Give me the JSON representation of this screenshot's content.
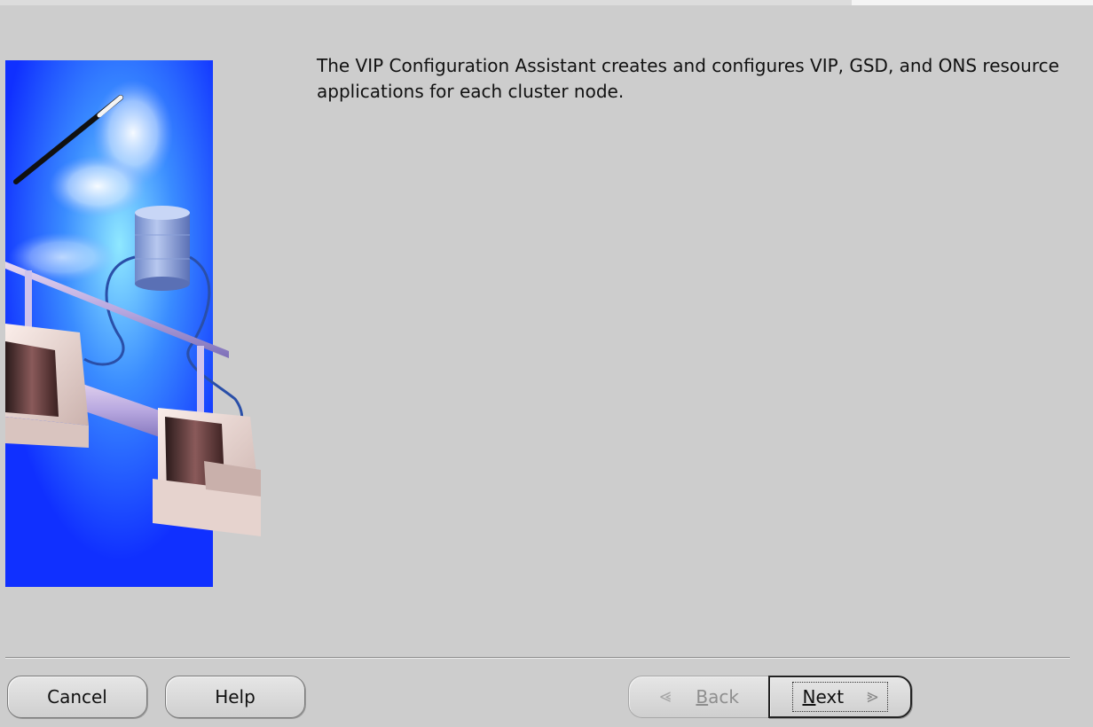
{
  "description": {
    "text": "The VIP Configuration Assistant creates and configures VIP, GSD, and ONS resource applications for each cluster node."
  },
  "illustration": {
    "icon": "cluster-network-illustration",
    "background_color": "#1a3cff"
  },
  "buttons": {
    "cancel": {
      "label": "Cancel"
    },
    "help": {
      "label": "Help"
    },
    "back": {
      "label_mnemonic": "B",
      "label_rest": "ack",
      "enabled": false,
      "icon": "chevron-left-icon"
    },
    "next": {
      "label_mnemonic": "N",
      "label_rest": "ext",
      "enabled": true,
      "focused": true,
      "icon": "chevron-right-icon"
    }
  }
}
